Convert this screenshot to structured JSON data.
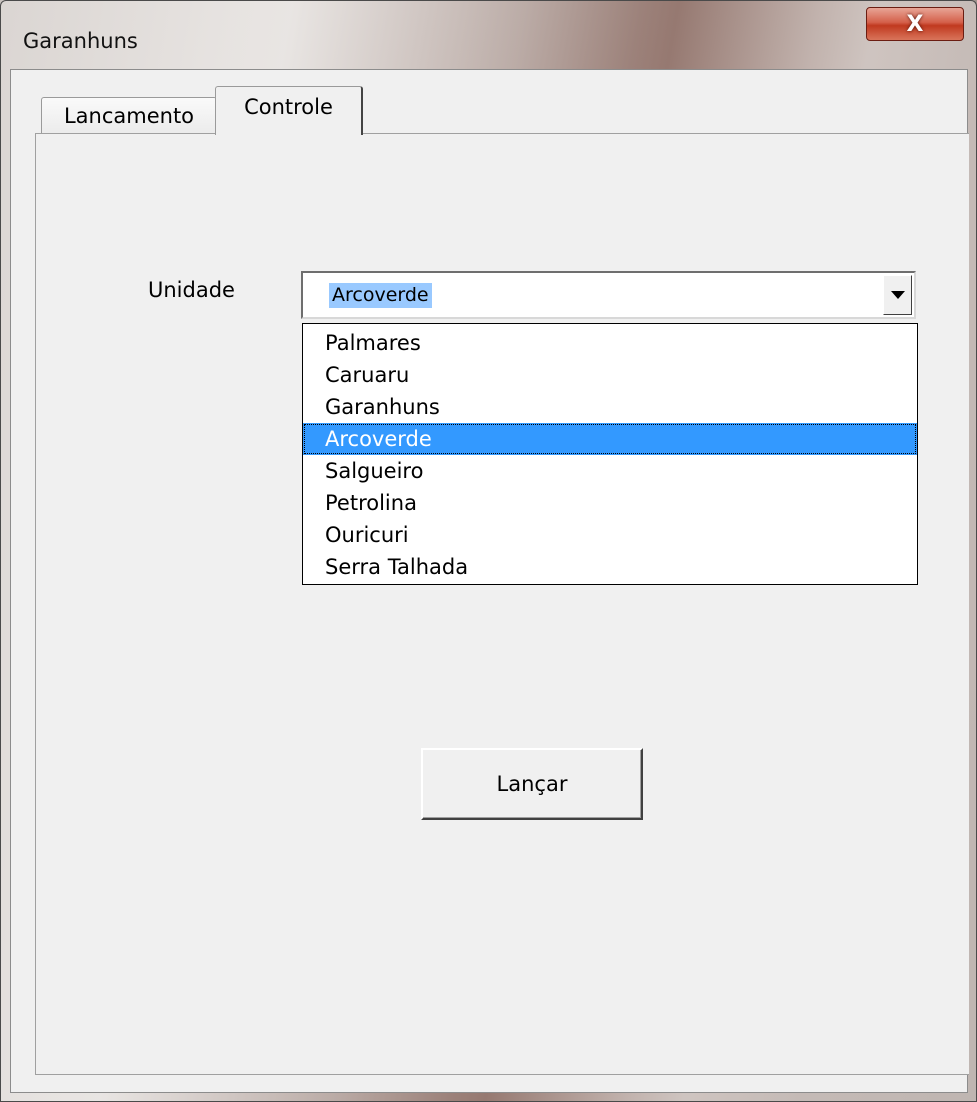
{
  "window": {
    "title": "Garanhuns",
    "close_symbol": "X"
  },
  "tabs": [
    {
      "label": "Lancamento",
      "active": false
    },
    {
      "label": "Controle",
      "active": true
    }
  ],
  "form": {
    "unidade_label": "Unidade",
    "unidade_value": "Arcoverde",
    "options": [
      "Palmares",
      "Caruaru",
      "Garanhuns",
      "Arcoverde",
      "Salgueiro",
      "Petrolina",
      "Ouricuri",
      "Serra Talhada"
    ],
    "selected_index": 3,
    "launch_button": "Lançar"
  },
  "icons": {
    "close": "close-icon",
    "dropdown_arrow": "chevron-down-icon"
  },
  "colors": {
    "selection": "#3399ff",
    "text_highlight": "#99c9ff",
    "close_button": "#c0391f",
    "dialog_background": "#f0f0f0"
  }
}
